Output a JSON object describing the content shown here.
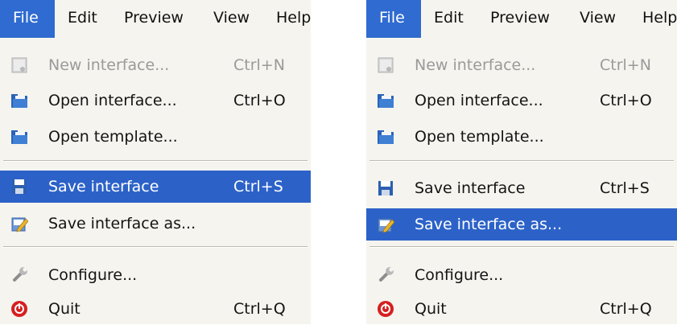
{
  "menubar": {
    "file": "File",
    "edit": "Edit",
    "preview": "Preview",
    "view": "View",
    "help": "Help"
  },
  "menu": {
    "new_interface": {
      "label": "New interface...",
      "shortcut": "Ctrl+N",
      "icon": "new-document-icon"
    },
    "open_interface": {
      "label": "Open interface...",
      "shortcut": "Ctrl+O",
      "icon": "folder-icon"
    },
    "open_template": {
      "label": "Open template...",
      "icon": "folder-icon"
    },
    "save_interface": {
      "label": "Save interface",
      "shortcut": "Ctrl+S",
      "icon": "floppy-disk-icon"
    },
    "save_interface_as": {
      "label": "Save interface as...",
      "icon": "save-as-pencil-icon"
    },
    "configure": {
      "label": "Configure...",
      "icon": "wrench-icon"
    },
    "quit": {
      "label": "Quit",
      "shortcut": "Ctrl+Q",
      "icon": "power-icon"
    }
  },
  "colors": {
    "highlight": "#2c62c8",
    "menu_background": "#f5f4ef",
    "disabled_text": "#9a9a9a"
  }
}
